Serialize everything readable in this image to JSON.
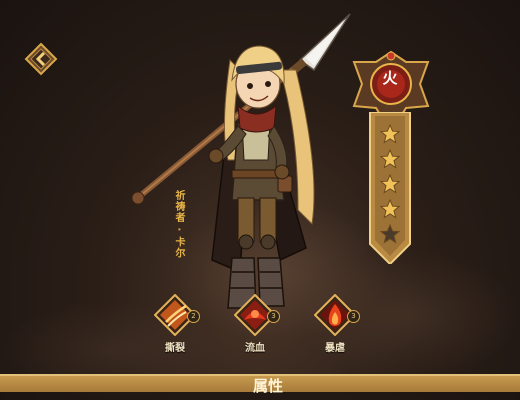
{
  "character": {
    "name": "祈祷者 · 卡尔"
  },
  "rank": {
    "emblem_char": "火",
    "stars_total": 5,
    "stars_filled": 4
  },
  "skills": [
    {
      "label": "撕裂",
      "level": "2",
      "icon": "claw-slash-icon"
    },
    {
      "label": "流血",
      "level": "3",
      "icon": "blood-drop-icon"
    },
    {
      "label": "暴虐",
      "level": "3",
      "icon": "flame-icon"
    }
  ],
  "bottom_banner": {
    "title": "属性"
  },
  "colors": {
    "gold": "#d9a74a",
    "accent": "#e8b548",
    "star_filled": "#f1c257",
    "star_empty": "#4a3a2a"
  }
}
